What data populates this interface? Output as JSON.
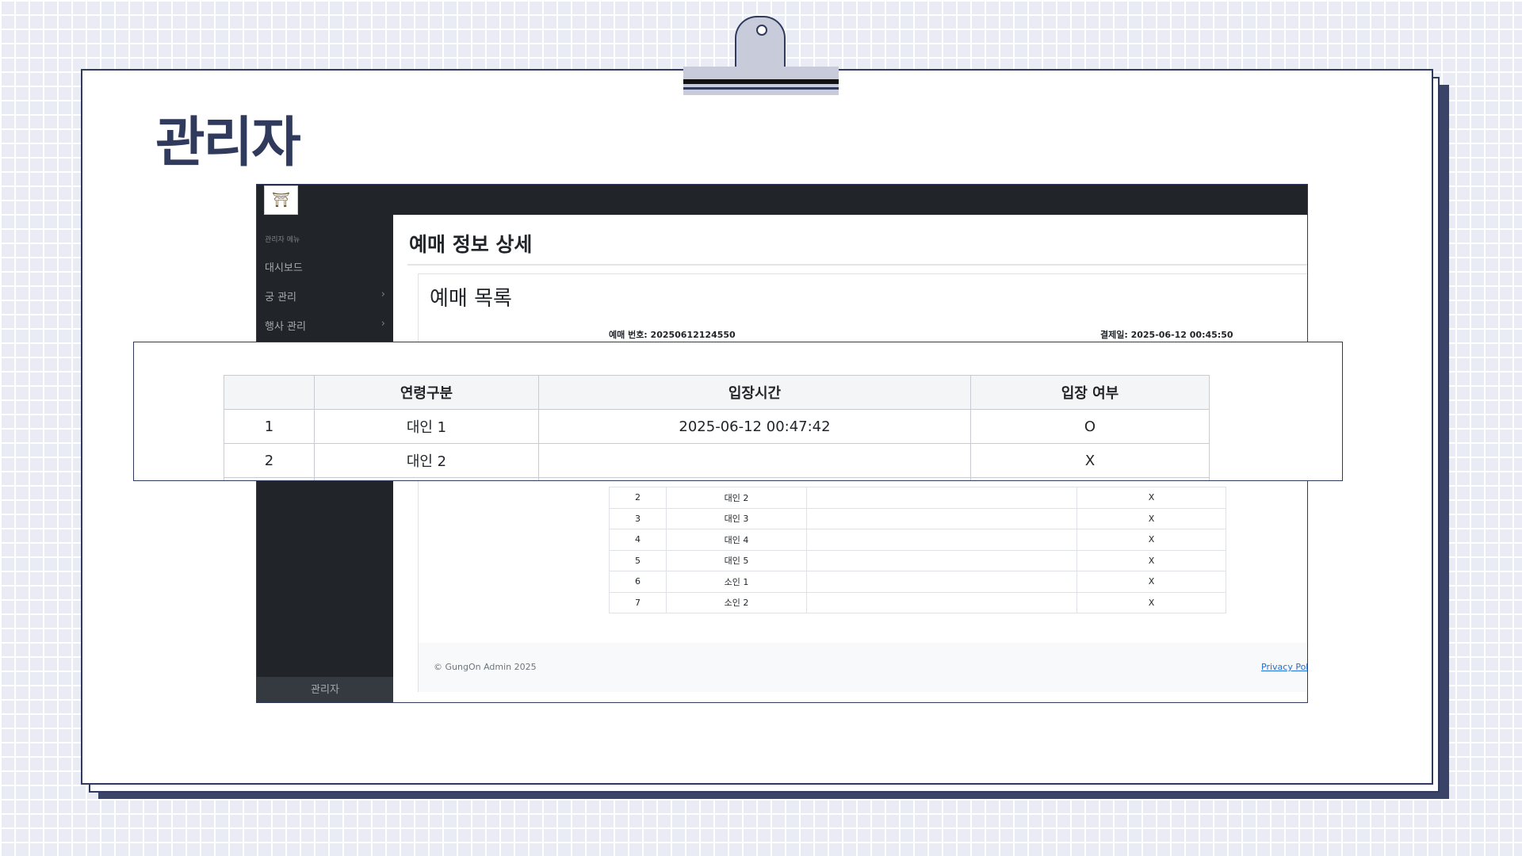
{
  "slide": {
    "title": "관리자"
  },
  "admin": {
    "logo_icon": "palace-logo",
    "sidebar": {
      "heading": "관리자 메뉴",
      "items": [
        {
          "label": "대시보드",
          "chevron": false
        },
        {
          "label": "궁 관리",
          "chevron": true
        },
        {
          "label": "행사 관리",
          "chevron": true
        }
      ],
      "footer": "관리자"
    },
    "page_title": "예매 정보 상세",
    "card_title": "예매 목록",
    "reservation_no": "예매 번호: 20250612124550",
    "payment_date": "결제일: 2025-06-12 00:45:50",
    "tickets": [
      {
        "no": "2",
        "type": "대인 2",
        "time": "",
        "entered": "X"
      },
      {
        "no": "3",
        "type": "대인 3",
        "time": "",
        "entered": "X"
      },
      {
        "no": "4",
        "type": "대인 4",
        "time": "",
        "entered": "X"
      },
      {
        "no": "5",
        "type": "대인 5",
        "time": "",
        "entered": "X"
      },
      {
        "no": "6",
        "type": "소인 1",
        "time": "",
        "entered": "X"
      },
      {
        "no": "7",
        "type": "소인 2",
        "time": "",
        "entered": "X"
      }
    ],
    "footer_copyright": "© GungOn Admin 2025",
    "footer_link": "Privacy Polic"
  },
  "zoom": {
    "headers": [
      "",
      "연령구분",
      "입장시간",
      "입장 여부"
    ],
    "rows": [
      {
        "no": "1",
        "type": "대인 1",
        "time": "2025-06-12 00:47:42",
        "entered": "O"
      },
      {
        "no": "2",
        "type": "대인 2",
        "time": "",
        "entered": "X"
      }
    ]
  }
}
